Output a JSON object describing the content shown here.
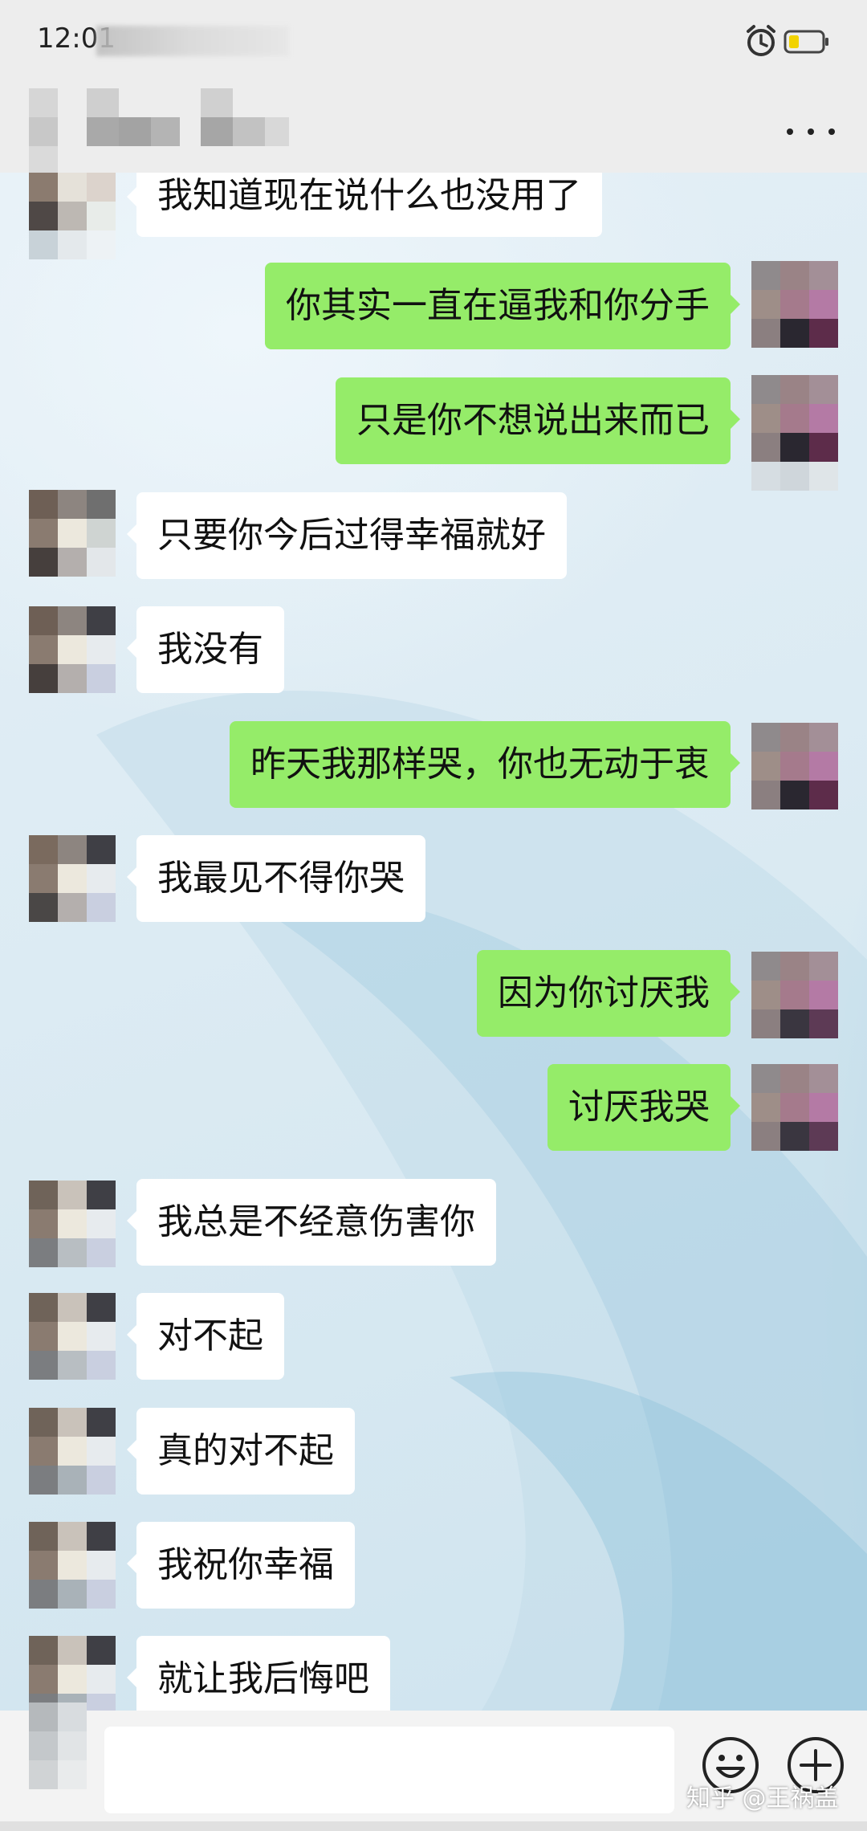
{
  "status_bar": {
    "time": "12:01",
    "icons": [
      "alarm-icon",
      "battery-icon"
    ],
    "battery_color": "#f2d300"
  },
  "header": {
    "more_icon": "more-dots-icon"
  },
  "colors": {
    "sent_bubble": "#95ec69",
    "received_bubble": "#ffffff",
    "header_bg": "#ededed"
  },
  "messages": [
    {
      "side": "left",
      "text": "我知道现在说什么也没用了"
    },
    {
      "side": "right",
      "text": "你其实一直在逼我和你分手"
    },
    {
      "side": "right",
      "text": "只是你不想说出来而已"
    },
    {
      "side": "left",
      "text": "只要你今后过得幸福就好"
    },
    {
      "side": "left",
      "text": "我没有"
    },
    {
      "side": "right",
      "text": "昨天我那样哭，你也无动于衷"
    },
    {
      "side": "left",
      "text": "我最见不得你哭"
    },
    {
      "side": "right",
      "text": "因为你讨厌我"
    },
    {
      "side": "right",
      "text": "讨厌我哭"
    },
    {
      "side": "left",
      "text": "我总是不经意伤害你"
    },
    {
      "side": "left",
      "text": "对不起"
    },
    {
      "side": "left",
      "text": "真的对不起"
    },
    {
      "side": "left",
      "text": "我祝你幸福"
    },
    {
      "side": "left",
      "text": "就让我后悔吧"
    }
  ],
  "input_bar": {
    "icons": [
      "emoji-icon",
      "plus-icon"
    ]
  },
  "watermark": "知乎 @王祸盖"
}
